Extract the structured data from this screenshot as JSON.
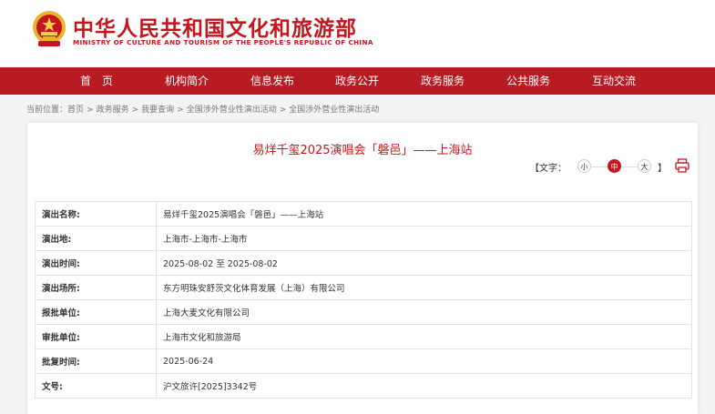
{
  "header": {
    "brand_cn": "中华人民共和国文化和旅游部",
    "brand_en": "MINISTRY OF CULTURE AND TOURISM OF THE PEOPLE'S REPUBLIC OF CHINA",
    "emblem_icon": "national-emblem-icon"
  },
  "colors": {
    "brand_red": "#c4161c",
    "nav_red": "#b81c22"
  },
  "nav": {
    "items": [
      {
        "label": "首　页"
      },
      {
        "label": "机构简介"
      },
      {
        "label": "信息发布"
      },
      {
        "label": "政务公开"
      },
      {
        "label": "政务服务"
      },
      {
        "label": "公共服务"
      },
      {
        "label": "互动交流"
      }
    ]
  },
  "breadcrumb": {
    "prefix": "当前位置：",
    "items": [
      {
        "label": "首页"
      },
      {
        "label": "政务服务"
      },
      {
        "label": "我要查询"
      },
      {
        "label": "全国涉外营业性演出活动"
      },
      {
        "label": "全国涉外营业性演出活动"
      }
    ],
    "separator": ">"
  },
  "article": {
    "title": "易烊千玺2025演唱会「磐邑」——上海站",
    "font_size_label": "【文字：",
    "font_size_options": [
      "小",
      "中",
      "大"
    ],
    "font_size_selected": "中",
    "font_size_close": "】",
    "print_icon": "print-icon"
  },
  "details": {
    "rows": [
      {
        "label": "演出名称:",
        "value": "易烊千玺2025演唱会「磐邑」——上海站"
      },
      {
        "label": "演出地:",
        "value": "上海市-上海市-上海市"
      },
      {
        "label": "演出时间:",
        "value": "2025-08-02 至 2025-08-02"
      },
      {
        "label": "演出场所:",
        "value": "东方明珠安舒茨文化体育发展（上海）有限公司"
      },
      {
        "label": "报批单位:",
        "value": "上海大麦文化有限公司"
      },
      {
        "label": "审批单位:",
        "value": "上海市文化和旅游局"
      },
      {
        "label": "批复时间:",
        "value": "2025-06-24"
      },
      {
        "label": "文号:",
        "value": "沪文旅许[2025]3342号"
      }
    ]
  }
}
